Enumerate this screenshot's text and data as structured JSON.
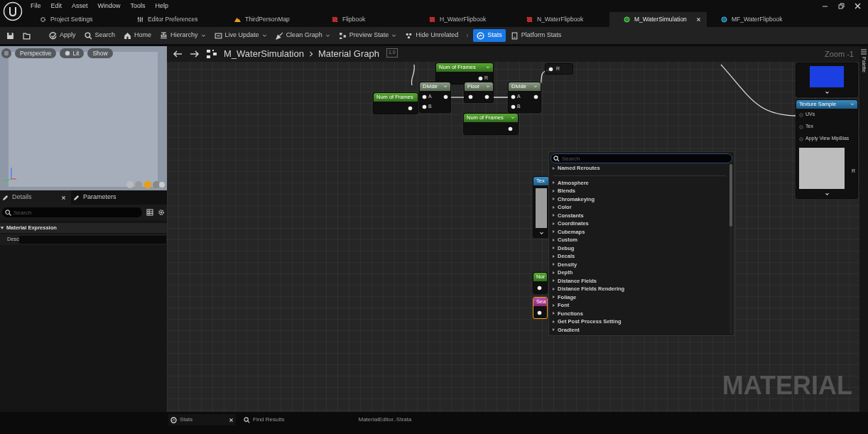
{
  "menu": [
    "File",
    "Edit",
    "Asset",
    "Window",
    "Tools",
    "Help"
  ],
  "tabs": [
    {
      "label": "Project Settings",
      "selected": false
    },
    {
      "label": "Editor Preferences",
      "selected": false
    },
    {
      "label": "ThirdPersonMap",
      "selected": false
    },
    {
      "label": "Flipbook",
      "selected": false
    },
    {
      "label": "H_WaterFlipbook",
      "selected": false
    },
    {
      "label": "N_WaterFlipbook",
      "selected": false
    },
    {
      "label": "M_WaterSimulation",
      "selected": true
    },
    {
      "label": "MF_WaterFlipbook",
      "selected": false
    }
  ],
  "toolbar": [
    {
      "kind": "icon"
    },
    {
      "kind": "icon"
    },
    {
      "label": "Apply",
      "kind": "button",
      "selected": false
    },
    {
      "label": "Search",
      "kind": "button",
      "selected": false
    },
    {
      "label": "Home",
      "kind": "button",
      "selected": false
    },
    {
      "label": "Hierarchy",
      "kind": "dropdown",
      "selected": false
    },
    {
      "label": "Live Update",
      "kind": "dropdown",
      "selected": false
    },
    {
      "label": "Clean Graph",
      "kind": "dropdown",
      "selected": false
    },
    {
      "label": "Preview State",
      "kind": "dropdown",
      "selected": false
    },
    {
      "label": "Hide Unrelated",
      "kind": "button",
      "selected": false
    },
    {
      "kind": "more"
    },
    {
      "label": "Stats",
      "kind": "button",
      "selected": true
    },
    {
      "label": "Platform Stats",
      "kind": "button",
      "selected": false
    }
  ],
  "viewport": {
    "buttons": [
      "Perspective",
      "Lit",
      "Show"
    ]
  },
  "details": {
    "tabs": [
      {
        "label": "Details",
        "selected": true
      },
      {
        "label": "Parameters",
        "selected": false
      }
    ],
    "search": {
      "placeholder": "Search"
    },
    "sections": [
      {
        "title": "Material Expression",
        "expanded": true,
        "properties": [
          {
            "label": "Desc"
          }
        ]
      }
    ]
  },
  "graph": {
    "breadcrumb": [
      "M_WaterSimulation",
      "Material Graph"
    ],
    "scale": "1.0",
    "zoom": "Zoom -1",
    "label": "MATERIAL",
    "nodes": [
      {
        "title": "Num of Frames",
        "kind": "param",
        "selected": false,
        "outputs": [
          "R"
        ]
      },
      {
        "kind": "reroute",
        "selected": false,
        "outputs": [
          "R"
        ]
      },
      {
        "title": "Num of Frames",
        "kind": "param",
        "selected": false
      },
      {
        "title": "Divide",
        "kind": "math",
        "selected": false,
        "inputs": [
          "A",
          "B"
        ]
      },
      {
        "title": "Floor",
        "kind": "math",
        "selected": false
      },
      {
        "title": "Divide",
        "kind": "math",
        "selected": false,
        "inputs": [
          "A",
          "B"
        ]
      },
      {
        "title": "Num of Frames",
        "kind": "param",
        "selected": false
      },
      {
        "kind": "preview",
        "selected": false
      },
      {
        "title": "Texture Sample",
        "kind": "texture",
        "selected": false,
        "inputs": [
          "UVs",
          "Tex",
          "Apply View MipBias"
        ],
        "outputs": [
          "R"
        ]
      },
      {
        "title": "Tex",
        "kind": "texture",
        "selected": false
      },
      {
        "title": "Nur",
        "kind": "param",
        "selected": false
      },
      {
        "title": "Sea",
        "kind": "function",
        "selected": true
      }
    ]
  },
  "context_menu": {
    "search": {
      "placeholder": "Search"
    },
    "pinned": [
      {
        "label": "Named Reroutes",
        "expanded": false
      }
    ],
    "items": [
      {
        "label": "Atmosphere",
        "expanded": false
      },
      {
        "label": "Blends",
        "expanded": false
      },
      {
        "label": "Chromakeying",
        "expanded": false
      },
      {
        "label": "Color",
        "expanded": false
      },
      {
        "label": "Constants",
        "expanded": false
      },
      {
        "label": "Coordinates",
        "expanded": false
      },
      {
        "label": "Cubemaps",
        "expanded": false
      },
      {
        "label": "Custom",
        "expanded": false
      },
      {
        "label": "Debug",
        "expanded": false
      },
      {
        "label": "Decals",
        "expanded": false
      },
      {
        "label": "Density",
        "expanded": false
      },
      {
        "label": "Depth",
        "expanded": false
      },
      {
        "label": "Distance Fields",
        "expanded": false
      },
      {
        "label": "Distance Fields Rendering",
        "expanded": false
      },
      {
        "label": "Foliage",
        "expanded": false
      },
      {
        "label": "Font",
        "expanded": false
      },
      {
        "label": "Functions",
        "expanded": false
      },
      {
        "label": "Get Post Process Setting",
        "expanded": false
      },
      {
        "label": "Gradient",
        "expanded": false
      }
    ]
  },
  "palette": {
    "label": "Palette"
  },
  "bottom_tabs": [
    {
      "label": "Stats",
      "selected": true
    },
    {
      "label": "Find Results",
      "selected": false
    },
    {
      "label": "MaterialEditor..Strata",
      "selected": false
    }
  ]
}
